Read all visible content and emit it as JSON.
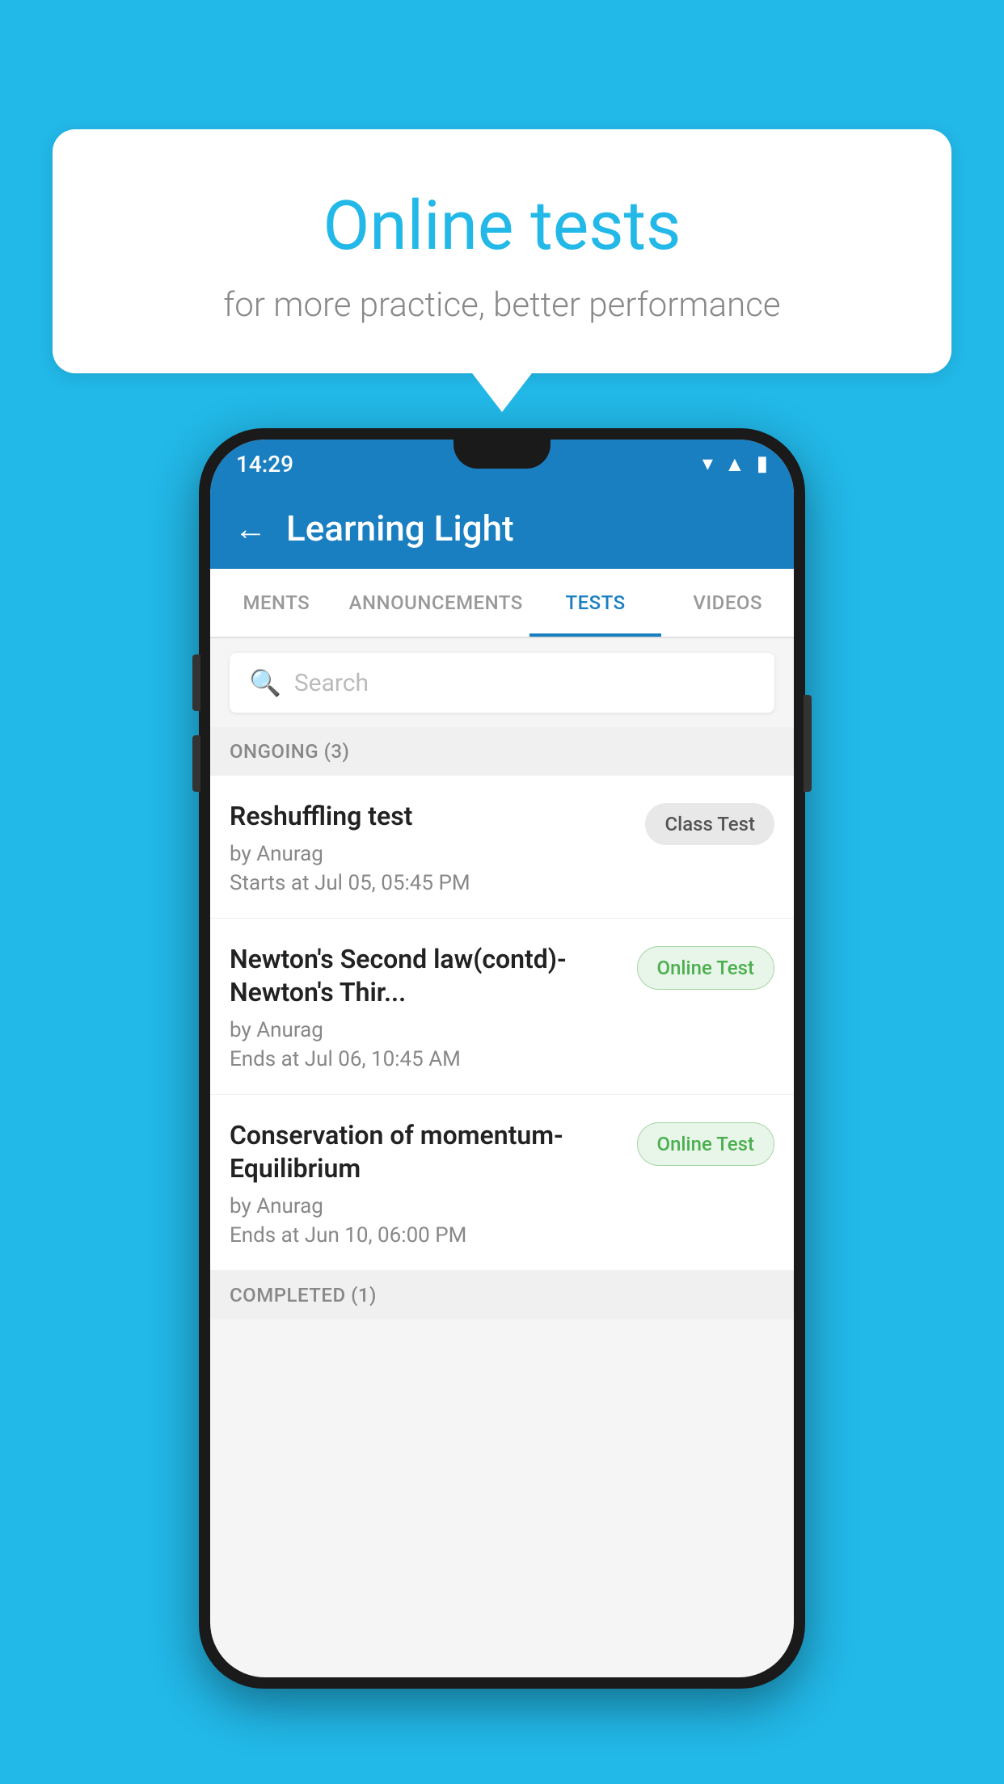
{
  "background": {
    "color": "#22b8e8"
  },
  "bubble": {
    "title": "Online tests",
    "subtitle": "for more practice, better performance"
  },
  "phone": {
    "status_bar": {
      "time": "14:29",
      "icons": [
        "wifi",
        "signal",
        "battery"
      ]
    },
    "app_bar": {
      "back_label": "←",
      "title": "Learning Light"
    },
    "tabs": [
      {
        "label": "MENTS",
        "active": false
      },
      {
        "label": "ANNOUNCEMENTS",
        "active": false
      },
      {
        "label": "TESTS",
        "active": true
      },
      {
        "label": "VIDEOS",
        "active": false
      }
    ],
    "search": {
      "placeholder": "Search"
    },
    "ongoing_section": {
      "title": "ONGOING (3)"
    },
    "tests": [
      {
        "name": "Reshuffling test",
        "by": "by Anurag",
        "date": "Starts at  Jul 05, 05:45 PM",
        "badge": "Class Test",
        "badge_type": "class"
      },
      {
        "name": "Newton's Second law(contd)-Newton's Thir...",
        "by": "by Anurag",
        "date": "Ends at  Jul 06, 10:45 AM",
        "badge": "Online Test",
        "badge_type": "online"
      },
      {
        "name": "Conservation of momentum-Equilibrium",
        "by": "by Anurag",
        "date": "Ends at  Jun 10, 06:00 PM",
        "badge": "Online Test",
        "badge_type": "online"
      }
    ],
    "completed_section": {
      "title": "COMPLETED (1)"
    }
  }
}
